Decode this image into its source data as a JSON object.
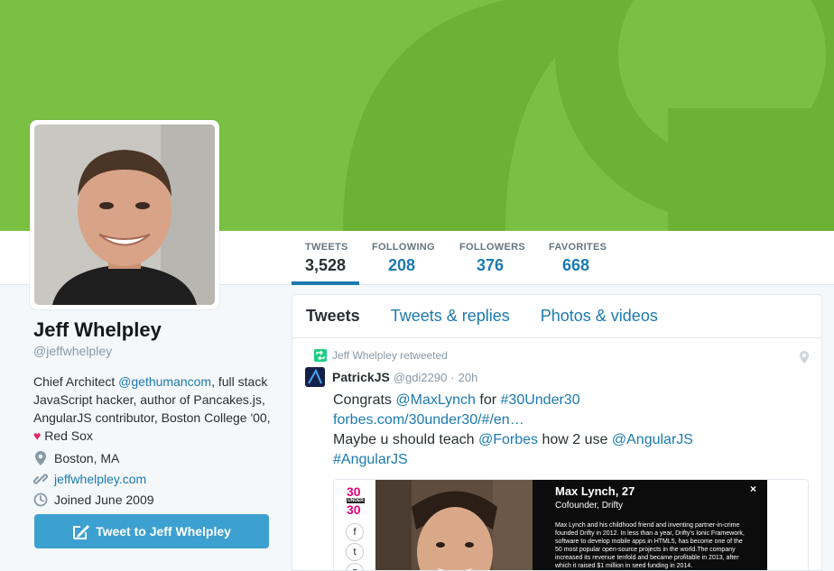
{
  "colors": {
    "banner": "#7ac143",
    "accent": "#1b7ab0",
    "button": "#3ca0d0",
    "heart": "#e0245e"
  },
  "stats": [
    {
      "label": "TWEETS",
      "value": "3,528"
    },
    {
      "label": "FOLLOWING",
      "value": "208"
    },
    {
      "label": "FOLLOWERS",
      "value": "376"
    },
    {
      "label": "FAVORITES",
      "value": "668"
    }
  ],
  "profile": {
    "name": "Jeff Whelpley",
    "handle": "@jeffwhelpley",
    "bio_1": "Chief Architect ",
    "bio_mention": "@gethumancom",
    "bio_2": ", full stack JavaScript hacker, author of Pancakes.js, AngularJS contributor, Boston College '00, ",
    "bio_heart": "♥",
    "bio_3": " Red Sox",
    "location": "Boston, MA",
    "website": "jeffwhelpley.com",
    "joined": "Joined June 2009",
    "tweet_to_label": "Tweet to Jeff Whelpley"
  },
  "tabs": [
    {
      "label": "Tweets"
    },
    {
      "label": "Tweets & replies"
    },
    {
      "label": "Photos & videos"
    }
  ],
  "tweet": {
    "retweeted_by": "Jeff Whelpley retweeted",
    "author": "PatrickJS",
    "author_handle": "@gdi2290",
    "dot": "·",
    "time": "20h",
    "text_1": "Congrats ",
    "mention_1": "@MaxLynch",
    "text_2": " for ",
    "hashtag_1": "#30Under30",
    "url": "forbes.com/30under30/#/en…",
    "text_3": "Maybe u should teach ",
    "mention_2": "@Forbes",
    "text_4": " how 2 use ",
    "mention_3": "@AngularJS",
    "hashtag_2": "#AngularJS"
  },
  "media": {
    "logo_top": "30",
    "logo_mid": "UNDER",
    "logo_bot": "30",
    "share_icons": [
      "f",
      "t",
      "g"
    ],
    "card_title": "Max Lynch, 27",
    "card_subtitle": "Cofounder, Drifty",
    "card_body": "Max Lynch and his childhood friend and inventing partner-in-crime founded Drifty in 2012. In less than a year, Drifty's Ionic Framework, software to develop mobile apps in HTML5, has become one of the 50 most popular open-source projects in the world.The company increased its revenue tenfold and became profitable in 2013, after which it raised $1 million in seed funding in 2014.",
    "close": "×"
  },
  "icons": {
    "retweet": "retweet-icon",
    "pin": "location-pin-icon",
    "location": "map-marker-icon",
    "link": "link-icon",
    "calendar": "calendar-icon",
    "compose": "compose-icon"
  }
}
